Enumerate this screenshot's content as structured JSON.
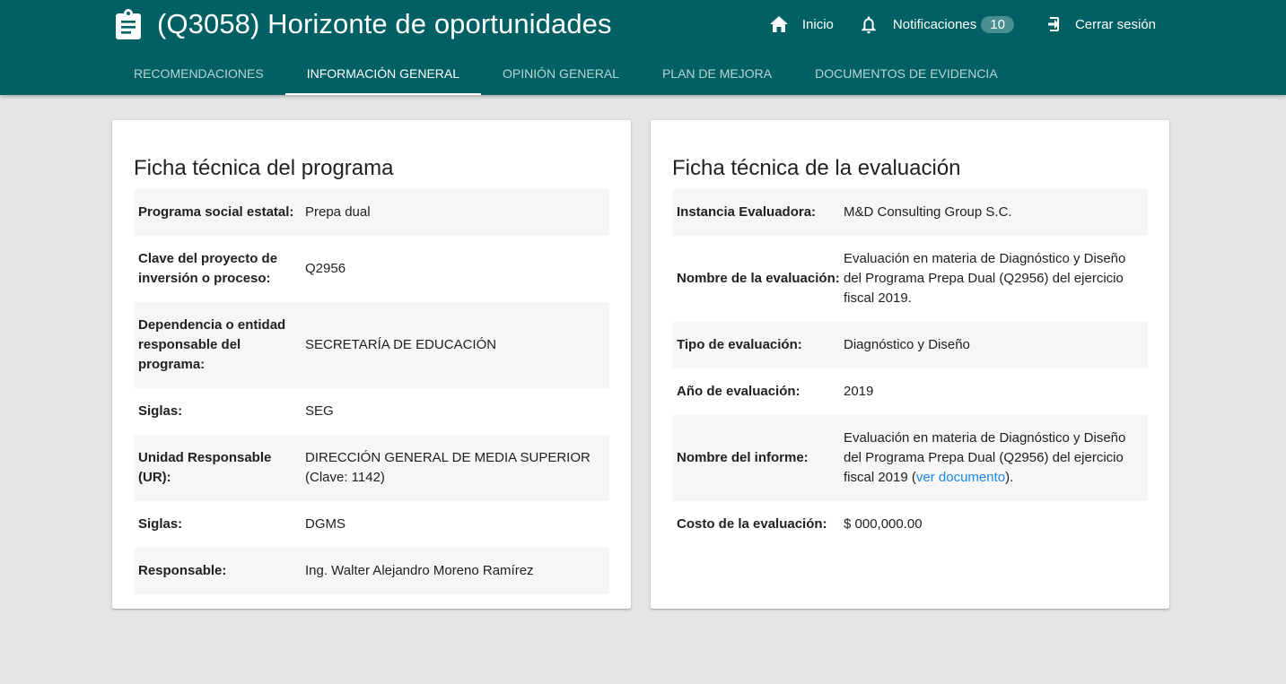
{
  "header": {
    "title": "(Q3058) Horizonte de oportunidades",
    "title_icon": "clipboard-icon",
    "nav": {
      "home_label": "Inicio",
      "notifications_label": "Notificaciones",
      "notifications_count": "10",
      "logout_label": "Cerrar sesión"
    },
    "tabs": [
      {
        "label": "Recomendaciones"
      },
      {
        "label": "Información general"
      },
      {
        "label": "Opinión general"
      },
      {
        "label": "Plan de mejora"
      },
      {
        "label": "Documentos de evidencia"
      }
    ],
    "active_tab": "Información general",
    "colors": {
      "primary": "#006064",
      "link": "#1e88e5"
    }
  },
  "program_card": {
    "title": "Ficha técnica del programa",
    "rows": [
      {
        "label": "Programa social estatal:",
        "value": "Prepa dual"
      },
      {
        "label": "Clave del proyecto de inversión o proceso:",
        "value": "Q2956"
      },
      {
        "label": "Dependencia o entidad responsable del programa:",
        "value": "SECRETARÍA DE EDUCACIÓN"
      },
      {
        "label": "Siglas:",
        "value": "SEG"
      },
      {
        "label": "Unidad Responsable (UR):",
        "value": "DIRECCIÓN GENERAL DE MEDIA SUPERIOR (Clave: 1142)"
      },
      {
        "label": "Siglas:",
        "value": "DGMS"
      },
      {
        "label": "Responsable:",
        "value": "Ing. Walter Alejandro Moreno Ramírez"
      }
    ]
  },
  "evaluation_card": {
    "title": "Ficha técnica de la evaluación",
    "rows": [
      {
        "label": "Instancia Evaluadora:",
        "value": "M&D Consulting Group S.C."
      },
      {
        "label": "Nombre de la evaluación:",
        "value": "Evaluación en materia de Diagnóstico y Diseño del Programa Prepa Dual (Q2956) del ejercicio fiscal 2019."
      },
      {
        "label": "Tipo de evaluación:",
        "value": "Diagnóstico y Diseño"
      },
      {
        "label": "Año de evaluación:",
        "value": "2019"
      },
      {
        "label": "Nombre del informe:",
        "value_prefix": "Evaluación en materia de Diagnóstico y Diseño del Programa Prepa Dual (Q2956) del ejercicio fiscal 2019 (",
        "link_text": "ver documento",
        "value_suffix": ")."
      },
      {
        "label": "Costo de la evaluación:",
        "value": "$ 000,000.00"
      }
    ]
  }
}
